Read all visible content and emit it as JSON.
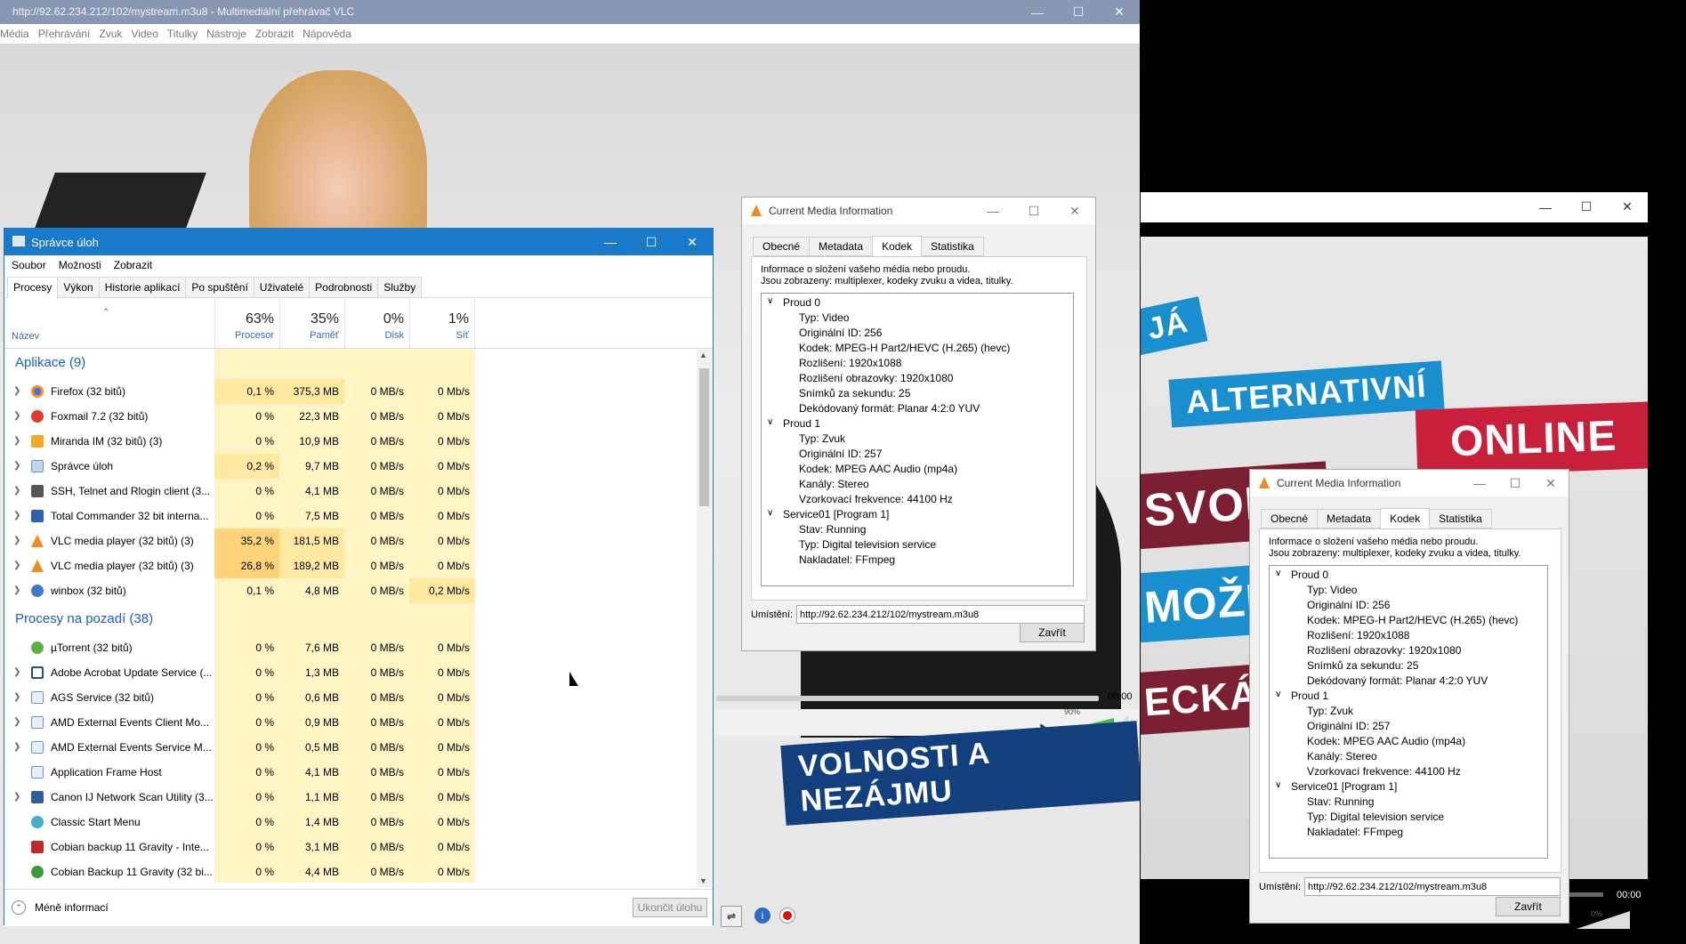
{
  "vlc": {
    "title": "http://92.62.234.212/102/mystream.m3u8 - Multimediální přehrávač VLC",
    "menu": [
      "Média",
      "Přehrávání",
      "Zvuk",
      "Video",
      "Titulky",
      "Nástroje",
      "Zobrazit",
      "Nápověda"
    ],
    "time": "00:00",
    "volume": "90%",
    "banner": "VOLNOSTI A NEZÁJMU"
  },
  "vlc2": {
    "banners": [
      "JÁ",
      "ALTERNATIVNÍ",
      "ONLINE",
      "SVOBO",
      "MOŽNOS",
      "ECKÁ"
    ],
    "time": "00:00",
    "volume": "0%"
  },
  "taskmanager": {
    "title": "Správce úloh",
    "menu": [
      "Soubor",
      "Možnosti",
      "Zobrazit"
    ],
    "tabs": [
      "Procesy",
      "Výkon",
      "Historie aplikací",
      "Po spuštění",
      "Uživatelé",
      "Podrobnosti",
      "Služby"
    ],
    "columns": {
      "name": "Název",
      "cpu_pct": "63%",
      "cpu": "Procesor",
      "mem_pct": "35%",
      "mem": "Paměť",
      "disk_pct": "0%",
      "disk": "Disk",
      "net_pct": "1%",
      "net": "Síť"
    },
    "apps_group": "Aplikace (9)",
    "bg_group": "Procesy na pozadí (38)",
    "apps": [
      {
        "name": "Firefox (32 bitů)",
        "cpu": "0,1 %",
        "mem": "375,3 MB",
        "disk": "0 MB/s",
        "net": "0 Mb/s"
      },
      {
        "name": "Foxmail 7.2 (32 bitů)",
        "cpu": "0 %",
        "mem": "22,3 MB",
        "disk": "0 MB/s",
        "net": "0 Mb/s"
      },
      {
        "name": "Miranda IM (32 bitů) (3)",
        "cpu": "0 %",
        "mem": "10,9 MB",
        "disk": "0 MB/s",
        "net": "0 Mb/s"
      },
      {
        "name": "Správce úloh",
        "cpu": "0,2 %",
        "mem": "9,7 MB",
        "disk": "0 MB/s",
        "net": "0 Mb/s"
      },
      {
        "name": "SSH, Telnet and Rlogin client (3...",
        "cpu": "0 %",
        "mem": "4,1 MB",
        "disk": "0 MB/s",
        "net": "0 Mb/s"
      },
      {
        "name": "Total Commander 32 bit interna...",
        "cpu": "0 %",
        "mem": "7,5 MB",
        "disk": "0 MB/s",
        "net": "0 Mb/s"
      },
      {
        "name": "VLC media player (32 bitů) (3)",
        "cpu": "35,2 %",
        "mem": "181,5 MB",
        "disk": "0 MB/s",
        "net": "0 Mb/s"
      },
      {
        "name": "VLC media player (32 bitů) (3)",
        "cpu": "26,8 %",
        "mem": "189,2 MB",
        "disk": "0 MB/s",
        "net": "0 Mb/s"
      },
      {
        "name": "winbox (32 bitů)",
        "cpu": "0,1 %",
        "mem": "4,8 MB",
        "disk": "0 MB/s",
        "net": "0,2 Mb/s"
      }
    ],
    "background": [
      {
        "name": "µTorrent (32 bitů)",
        "cpu": "0 %",
        "mem": "7,6 MB",
        "disk": "0 MB/s",
        "net": "0 Mb/s"
      },
      {
        "name": "Adobe Acrobat Update Service (...",
        "cpu": "0 %",
        "mem": "1,3 MB",
        "disk": "0 MB/s",
        "net": "0 Mb/s"
      },
      {
        "name": "AGS Service (32 bitů)",
        "cpu": "0 %",
        "mem": "0,6 MB",
        "disk": "0 MB/s",
        "net": "0 Mb/s"
      },
      {
        "name": "AMD External Events Client Mo...",
        "cpu": "0 %",
        "mem": "0,9 MB",
        "disk": "0 MB/s",
        "net": "0 Mb/s"
      },
      {
        "name": "AMD External Events Service M...",
        "cpu": "0 %",
        "mem": "0,5 MB",
        "disk": "0 MB/s",
        "net": "0 Mb/s"
      },
      {
        "name": "Application Frame Host",
        "cpu": "0 %",
        "mem": "4,1 MB",
        "disk": "0 MB/s",
        "net": "0 Mb/s"
      },
      {
        "name": "Canon IJ Network Scan Utility (3...",
        "cpu": "0 %",
        "mem": "1,1 MB",
        "disk": "0 MB/s",
        "net": "0 Mb/s"
      },
      {
        "name": "Classic Start Menu",
        "cpu": "0 %",
        "mem": "1,4 MB",
        "disk": "0 MB/s",
        "net": "0 Mb/s"
      },
      {
        "name": "Cobian backup 11 Gravity - Inte...",
        "cpu": "0 %",
        "mem": "3,1 MB",
        "disk": "0 MB/s",
        "net": "0 Mb/s"
      },
      {
        "name": "Cobian Backup 11 Gravity (32 bi...",
        "cpu": "0 %",
        "mem": "4,4 MB",
        "disk": "0 MB/s",
        "net": "0 Mb/s"
      }
    ],
    "less_info": "Méně informací",
    "end_task": "Ukončit úlohu"
  },
  "mediainfo": {
    "title": "Current Media Information",
    "tabs": [
      "Obecné",
      "Metadata",
      "Kodek",
      "Statistika"
    ],
    "desc1": "Informace o složení vašeho média nebo proudu.",
    "desc2": "Jsou zobrazeny: multiplexer, kodeky zvuku a videa, titulky.",
    "tree": [
      {
        "level": 0,
        "text": "Proud 0"
      },
      {
        "level": 1,
        "text": "Typ: Video"
      },
      {
        "level": 1,
        "text": "Originální ID: 256"
      },
      {
        "level": 1,
        "text": "Kodek: MPEG-H Part2/HEVC (H.265) (hevc)"
      },
      {
        "level": 1,
        "text": "Rozlišení: 1920x1088"
      },
      {
        "level": 1,
        "text": "Rozlišení obrazovky: 1920x1080"
      },
      {
        "level": 1,
        "text": "Snímků za sekundu: 25"
      },
      {
        "level": 1,
        "text": "Dekódovaný formát: Planar 4:2:0 YUV"
      },
      {
        "level": 0,
        "text": "Proud 1"
      },
      {
        "level": 1,
        "text": "Typ: Zvuk"
      },
      {
        "level": 1,
        "text": "Originální ID: 257"
      },
      {
        "level": 1,
        "text": "Kodek: MPEG AAC Audio (mp4a)"
      },
      {
        "level": 1,
        "text": "Kanály: Stereo"
      },
      {
        "level": 1,
        "text": "Vzorkovací frekvence: 44100 Hz"
      },
      {
        "level": 0,
        "text": "Service01 [Program 1]"
      },
      {
        "level": 1,
        "text": "Stav: Running"
      },
      {
        "level": 1,
        "text": "Typ: Digital television service"
      },
      {
        "level": 1,
        "text": "Nakladatel: FFmpeg"
      }
    ],
    "location_label": "Umístění:",
    "location_value": "http://92.62.234.212/102/mystream.m3u8",
    "close": "Zavřít"
  },
  "colors": {
    "taskmanager_title": "#1979ca",
    "vlc_title": "#8898b3",
    "vlc_orange": "#f18b1c",
    "banner_blue": "#1a8fcf",
    "banner_red": "#c8203a",
    "banner_darkred": "#7c1f33",
    "banner_navy": "#123f7e"
  }
}
